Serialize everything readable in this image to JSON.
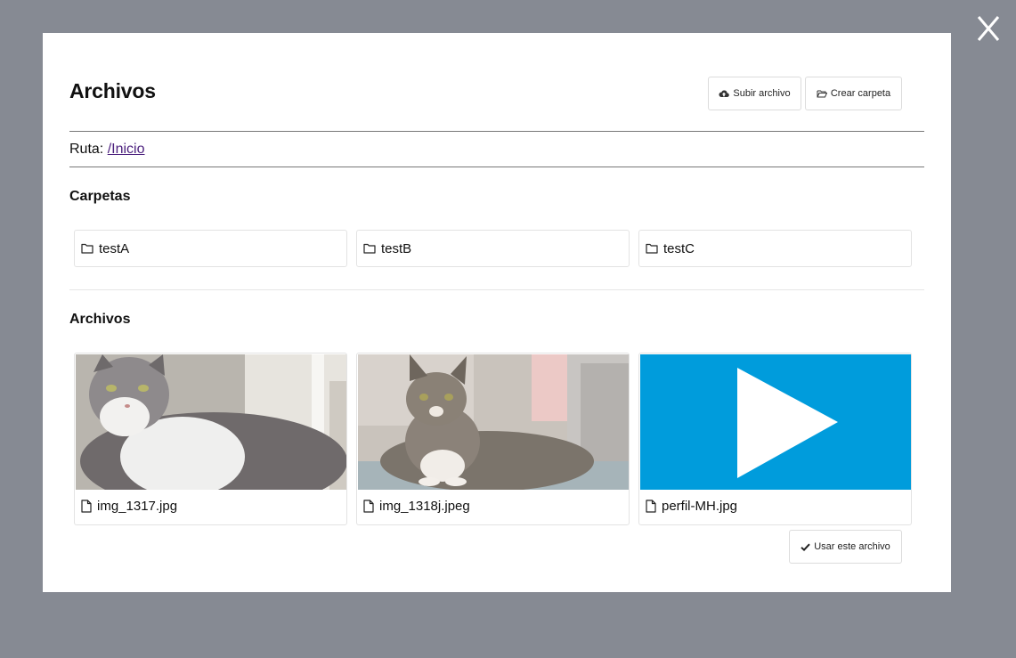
{
  "close_label": "X",
  "modal": {
    "title": "Archivos",
    "upload_label": "Subir archivo",
    "create_folder_label": "Crear carpeta",
    "path_label": "Ruta:",
    "path_link": "/Inicio",
    "folders_heading": "Carpetas",
    "folders": [
      {
        "name": "testA"
      },
      {
        "name": "testB"
      },
      {
        "name": "testC"
      }
    ],
    "files_heading": "Archivos",
    "files": [
      {
        "name": "img_1317.jpg",
        "thumbnail": "cat-photo"
      },
      {
        "name": "img_1318j.jpeg",
        "thumbnail": "cat-photo"
      },
      {
        "name": "perfil-MH.jpg",
        "thumbnail": "play-icon",
        "color": "#009cdc"
      }
    ],
    "use_file_label": "Usar este archivo"
  }
}
